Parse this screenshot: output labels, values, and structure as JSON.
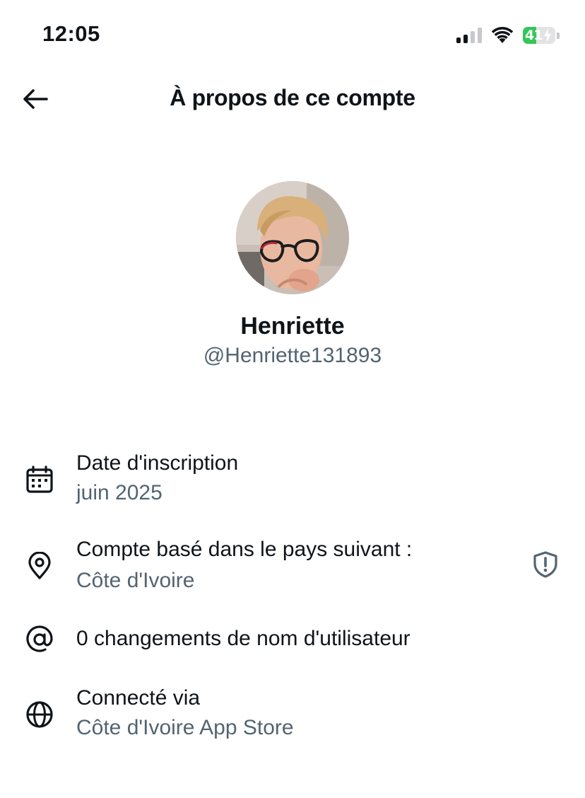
{
  "status_bar": {
    "time": "12:05",
    "battery_percent": "41",
    "signal_bars_active": 2,
    "signal_bars_total": 4
  },
  "header": {
    "title": "À propos de ce compte",
    "back_icon": "arrow-left-icon"
  },
  "profile": {
    "name": "Henriette",
    "handle": "@Henriette131893"
  },
  "details": {
    "joined": {
      "icon": "calendar-icon",
      "label": "Date d'inscription",
      "value": "juin 2025"
    },
    "country": {
      "icon": "location-pin-icon",
      "label": "Compte basé dans le pays suivant :",
      "value": "Côte d'Ivoire",
      "badge_icon": "shield-alert-icon"
    },
    "username_changes": {
      "icon": "at-sign-icon",
      "label": "0 changements de nom d'utilisateur"
    },
    "connected": {
      "icon": "globe-icon",
      "label": "Connecté via",
      "value": "Côte d'Ivoire App Store"
    }
  },
  "colors": {
    "text_primary": "#0f1419",
    "text_secondary": "#536471",
    "battery_green": "#34c759",
    "background": "#ffffff"
  }
}
